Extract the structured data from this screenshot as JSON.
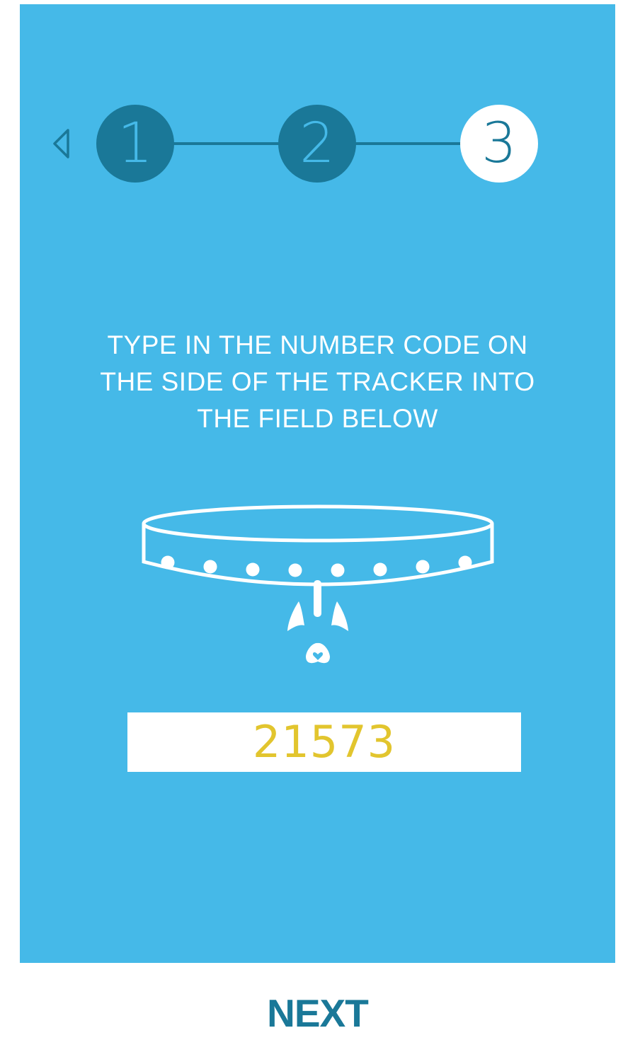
{
  "stepper": {
    "steps": [
      {
        "label": "1",
        "state": "done"
      },
      {
        "label": "2",
        "state": "done"
      },
      {
        "label": "3",
        "state": "active"
      }
    ],
    "current_step": 3
  },
  "instruction": {
    "lines": [
      "TYPE IN THE NUMBER CODE ON",
      "THE SIDE OF THE TRACKER INTO",
      "THE FIELD BELOW"
    ]
  },
  "code_field": {
    "value": "21573"
  },
  "next_button": {
    "label": "NEXT"
  },
  "icons": {
    "back": "back-arrow-icon",
    "illustration": "collar-tracker-icon"
  },
  "colors": {
    "background": "#45b9e8",
    "accent_dark": "#1a7898",
    "code_text": "#e2c52e",
    "white": "#ffffff"
  }
}
